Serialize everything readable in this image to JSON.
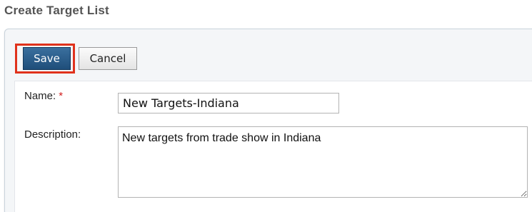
{
  "page": {
    "title": "Create Target List"
  },
  "toolbar": {
    "save_label": "Save",
    "cancel_label": "Cancel"
  },
  "form": {
    "name_label": "Name:",
    "required_marker": "*",
    "name_value": "New Targets-Indiana",
    "description_label": "Description:",
    "description_value": "New targets from trade show in Indiana"
  },
  "colors": {
    "save_button": "#2c5f8d",
    "highlight": "#e0321c",
    "required": "#d22020"
  }
}
